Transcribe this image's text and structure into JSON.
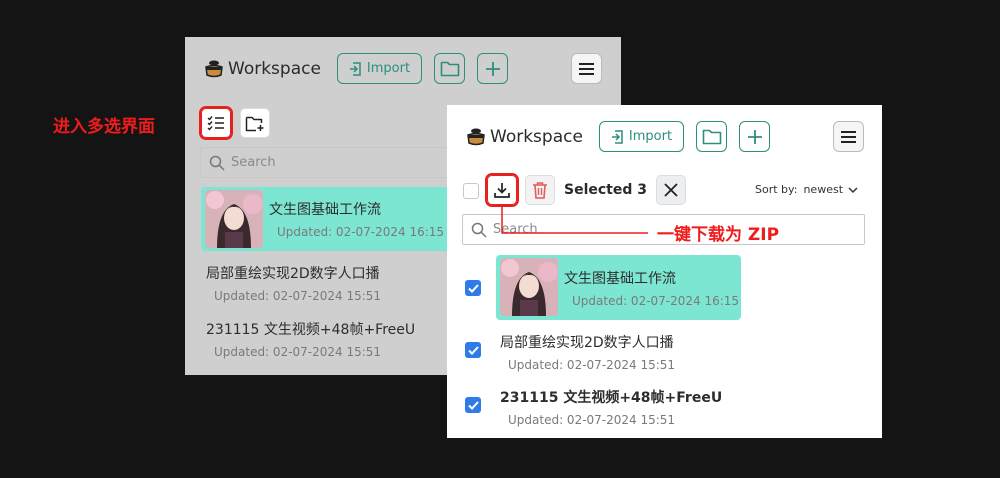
{
  "back_panel": {
    "logo_text": "Workspace",
    "import_label": "Import",
    "search_placeholder": "Search",
    "items": [
      {
        "title": "文生图基础工作流",
        "updated": "Updated: 02-07-2024 16:15"
      },
      {
        "title": "局部重绘实现2D数字人口播",
        "updated": "Updated: 02-07-2024 15:51"
      },
      {
        "title": "231115 文生视频+48帧+FreeU",
        "updated": "Updated: 02-07-2024 15:51"
      }
    ]
  },
  "front_panel": {
    "logo_text": "Workspace",
    "import_label": "Import",
    "selected_text": "Selected 3",
    "sort_label": "Sort by:",
    "sort_value": "newest",
    "search_placeholder": "Search",
    "items": [
      {
        "title": "文生图基础工作流",
        "updated": "Updated: 02-07-2024 16:15",
        "checked": true
      },
      {
        "title": "局部重绘实现2D数字人口播",
        "updated": "Updated: 02-07-2024 15:51",
        "checked": true
      },
      {
        "title": "231115 文生视频+48帧+FreeU",
        "updated": "Updated: 02-07-2024 15:51",
        "checked": true
      }
    ]
  },
  "annotations": {
    "multi_select": "进入多选界面",
    "download_zip": "一键下载为 ZIP"
  },
  "colors": {
    "accent": "#2c8f7e",
    "highlight": "#7de6d3",
    "annotation_red": "#f01c1c",
    "checkbox_blue": "#2f7be8"
  }
}
